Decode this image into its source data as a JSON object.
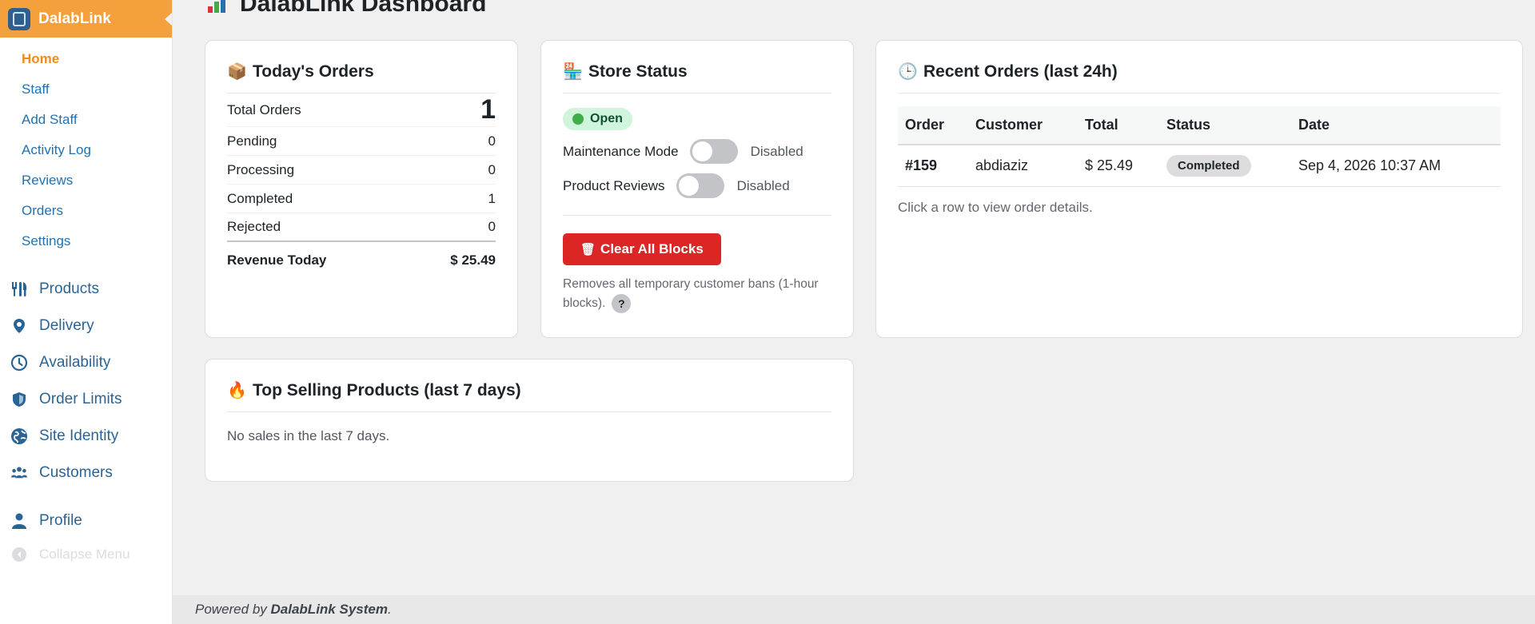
{
  "brand": {
    "name": "DalabLink"
  },
  "page": {
    "title": "DalabLink Dashboard"
  },
  "sidebar": {
    "sub_items": [
      {
        "label": "Home",
        "active": true
      },
      {
        "label": "Staff"
      },
      {
        "label": "Add Staff"
      },
      {
        "label": "Activity Log"
      },
      {
        "label": "Reviews"
      },
      {
        "label": "Orders"
      },
      {
        "label": "Settings"
      }
    ],
    "menu_items": [
      {
        "label": "Products",
        "icon": "utensils-icon"
      },
      {
        "label": "Delivery",
        "icon": "map-pin-icon"
      },
      {
        "label": "Availability",
        "icon": "clock-icon"
      },
      {
        "label": "Order Limits",
        "icon": "shield-icon"
      },
      {
        "label": "Site Identity",
        "icon": "globe-icon"
      },
      {
        "label": "Customers",
        "icon": "users-icon"
      }
    ],
    "profile": {
      "label": "Profile",
      "icon": "user-icon"
    },
    "collapse": {
      "label": "Collapse Menu",
      "icon": "collapse-icon"
    }
  },
  "todays_orders": {
    "title": "Today's Orders",
    "icon": "package-icon",
    "rows": [
      {
        "label": "Total Orders",
        "value": "1"
      },
      {
        "label": "Pending",
        "value": "0"
      },
      {
        "label": "Processing",
        "value": "0"
      },
      {
        "label": "Completed",
        "value": "1"
      },
      {
        "label": "Rejected",
        "value": "0"
      }
    ],
    "revenue_label": "Revenue Today",
    "revenue_value": "$ 25.49"
  },
  "store_status": {
    "title": "Store Status",
    "icon": "store-icon",
    "badge": "Open",
    "maintenance_label": "Maintenance Mode",
    "maintenance_state": "Disabled",
    "reviews_label": "Product Reviews",
    "reviews_state": "Disabled",
    "clear_button": "Clear All Blocks",
    "help_text": "Removes all temporary customer bans (1-hour blocks).",
    "help_q": "?"
  },
  "recent_orders": {
    "title": "Recent Orders (last 24h)",
    "icon": "clock-icon",
    "columns": [
      "Order",
      "Customer",
      "Total",
      "Status",
      "Date"
    ],
    "rows": [
      {
        "order": "#159",
        "customer": "abdiaziz",
        "total": "$ 25.49",
        "status": "Completed",
        "date": "Sep 4, 2026 10:37 AM"
      }
    ],
    "note": "Click a row to view order details."
  },
  "top_selling": {
    "title": "Top Selling Products (last 7 days)",
    "icon": "fire-icon",
    "empty": "No sales in the last 7 days."
  },
  "footer": {
    "prefix": "Powered by",
    "name": "DalabLink System",
    "suffix": "."
  },
  "colors": {
    "brand": "#f4a03d",
    "link": "#2271b1",
    "danger": "#dc2626",
    "open": "#3fae49"
  }
}
